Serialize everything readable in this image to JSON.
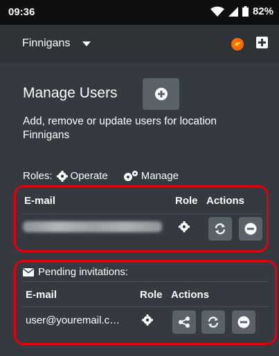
{
  "status_bar": {
    "time": "09:36",
    "battery": "82%"
  },
  "app_bar": {
    "location": "Finnigans"
  },
  "page": {
    "title": "Manage Users",
    "subtitle": "Add, remove or update users for location Finnigans"
  },
  "roles": {
    "label": "Roles:",
    "operate": "Operate",
    "manage": "Manage"
  },
  "users_table": {
    "headers": {
      "email": "E-mail",
      "role": "Role",
      "actions": "Actions"
    }
  },
  "pending": {
    "title": "Pending invitations:",
    "headers": {
      "email": "E-mail",
      "role": "Role",
      "actions": "Actions"
    },
    "rows": [
      {
        "email": "user@youremail.c…"
      }
    ]
  },
  "icons": {
    "status": [
      "wifi-icon",
      "signal-icon",
      "battery-icon"
    ],
    "app_bar": [
      "dropdown-caret-icon",
      "flame-icon",
      "add-icon"
    ],
    "actions": [
      "gear-icon",
      "share-icon",
      "refresh-icon",
      "remove-icon"
    ]
  },
  "colors": {
    "background": "#353a40",
    "button": "#5b6168",
    "highlight": "#e10010",
    "accent": "#ff6a00"
  }
}
